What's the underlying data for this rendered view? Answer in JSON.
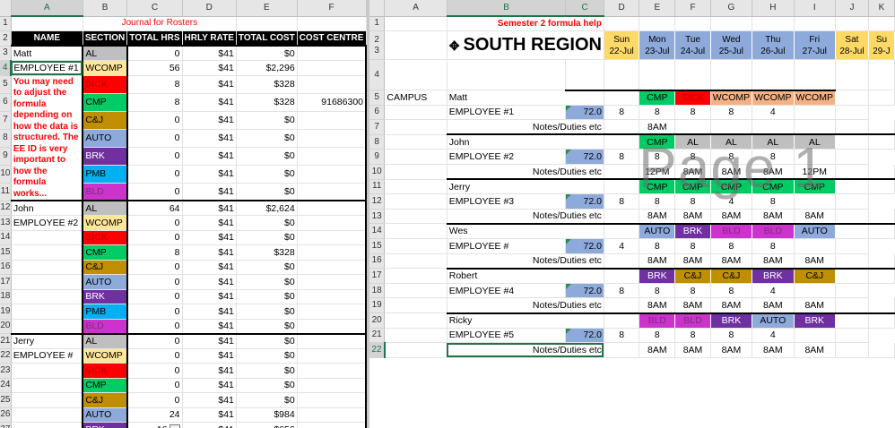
{
  "left": {
    "columns": [
      "A",
      "B",
      "C",
      "D",
      "E",
      "F"
    ],
    "row1_title": "Journal for Rosters",
    "headers": [
      "NAME",
      "SECTION",
      "TOTAL HRS",
      "HRLY RATE",
      "TOTAL COST",
      "COST CENTRE"
    ],
    "note": "You may need to adjust the formula depending on how the data is structured.  The EE ID is very important to how the formula works...",
    "rows": [
      {
        "n": "3",
        "a": "Matt",
        "b": "AL",
        "c": "0",
        "d": "$41",
        "e": "$0",
        "f": ""
      },
      {
        "n": "4",
        "a": "EMPLOYEE #1",
        "b": "WCOMP",
        "c": "56",
        "d": "$41",
        "e": "$2,296",
        "f": ""
      },
      {
        "n": "5",
        "a": "",
        "b": "SICK",
        "c": "8",
        "d": "$41",
        "e": "$328",
        "f": ""
      },
      {
        "n": "6",
        "a": "",
        "b": "CMP",
        "c": "8",
        "d": "$41",
        "e": "$328",
        "f": "91686300"
      },
      {
        "n": "7",
        "a": "",
        "b": "C&J",
        "c": "0",
        "d": "$41",
        "e": "$0",
        "f": ""
      },
      {
        "n": "8",
        "a": "",
        "b": "AUTO",
        "c": "0",
        "d": "$41",
        "e": "$0",
        "f": ""
      },
      {
        "n": "9",
        "a": "",
        "b": "BRK",
        "c": "0",
        "d": "$41",
        "e": "$0",
        "f": ""
      },
      {
        "n": "10",
        "a": "",
        "b": "PMB",
        "c": "0",
        "d": "$41",
        "e": "$0",
        "f": ""
      },
      {
        "n": "11",
        "a": "",
        "b": "BLD",
        "c": "0",
        "d": "$41",
        "e": "$0",
        "f": ""
      },
      {
        "n": "12",
        "a": "John",
        "b": "AL",
        "c": "64",
        "d": "$41",
        "e": "$2,624",
        "f": ""
      },
      {
        "n": "13",
        "a": "EMPLOYEE #2",
        "b": "WCOMP",
        "c": "0",
        "d": "$41",
        "e": "$0",
        "f": ""
      },
      {
        "n": "14",
        "a": "",
        "b": "SICK",
        "c": "0",
        "d": "$41",
        "e": "$0",
        "f": ""
      },
      {
        "n": "15",
        "a": "",
        "b": "CMP",
        "c": "8",
        "d": "$41",
        "e": "$328",
        "f": ""
      },
      {
        "n": "16",
        "a": "",
        "b": "C&J",
        "c": "0",
        "d": "$41",
        "e": "$0",
        "f": ""
      },
      {
        "n": "17",
        "a": "",
        "b": "AUTO",
        "c": "0",
        "d": "$41",
        "e": "$0",
        "f": ""
      },
      {
        "n": "18",
        "a": "",
        "b": "BRK",
        "c": "0",
        "d": "$41",
        "e": "$0",
        "f": ""
      },
      {
        "n": "19",
        "a": "",
        "b": "PMB",
        "c": "0",
        "d": "$41",
        "e": "$0",
        "f": ""
      },
      {
        "n": "20",
        "a": "",
        "b": "BLD",
        "c": "0",
        "d": "$41",
        "e": "$0",
        "f": ""
      },
      {
        "n": "21",
        "a": "Jerry",
        "b": "AL",
        "c": "0",
        "d": "$41",
        "e": "$0",
        "f": ""
      },
      {
        "n": "22",
        "a": "EMPLOYEE #",
        "b": "WCOMP",
        "c": "0",
        "d": "$41",
        "e": "$0",
        "f": ""
      },
      {
        "n": "23",
        "a": "",
        "b": "SICK",
        "c": "0",
        "d": "$41",
        "e": "$0",
        "f": ""
      },
      {
        "n": "24",
        "a": "",
        "b": "CMP",
        "c": "0",
        "d": "$41",
        "e": "$0",
        "f": ""
      },
      {
        "n": "25",
        "a": "",
        "b": "C&J",
        "c": "0",
        "d": "$41",
        "e": "$0",
        "f": ""
      },
      {
        "n": "26",
        "a": "",
        "b": "AUTO",
        "c": "24",
        "d": "$41",
        "e": "$984",
        "f": ""
      },
      {
        "n": "27",
        "a": "",
        "b": "BRK",
        "c": "16",
        "d": "$41",
        "e": "$656",
        "f": ""
      }
    ]
  },
  "right": {
    "columns": [
      "A",
      "B",
      "C",
      "D",
      "E",
      "F",
      "G",
      "H",
      "I",
      "J",
      "K"
    ],
    "row1_title": "Semester 2 formula help",
    "region_title": "SOUTH REGION",
    "campus_label": "CAMPUS",
    "watermark": "Page 1",
    "days": [
      {
        "day": "Sun",
        "date": "22-Jul",
        "weekend": true
      },
      {
        "day": "Mon",
        "date": "23-Jul",
        "weekend": false
      },
      {
        "day": "Tue",
        "date": "24-Jul",
        "weekend": false
      },
      {
        "day": "Wed",
        "date": "25-Jul",
        "weekend": false
      },
      {
        "day": "Thu",
        "date": "26-Jul",
        "weekend": false
      },
      {
        "day": "Fri",
        "date": "27-Jul",
        "weekend": false
      },
      {
        "day": "Sat",
        "date": "28-Jul",
        "weekend": true
      },
      {
        "day": "Su",
        "date": "29-J",
        "weekend": true
      }
    ],
    "notes_label": "Notes/Duties etc",
    "employees": [
      {
        "name": "Matt",
        "id": "EMPLOYEE #1",
        "total": "72.0",
        "codes": [
          "CMP",
          "SICK",
          "WCOMP",
          "WCOMP",
          "WCOMP"
        ],
        "hours": [
          "8",
          "8",
          "8",
          "8",
          "4"
        ],
        "times": [
          "8AM",
          "",
          "",
          "",
          ""
        ],
        "rows": [
          "5",
          "6",
          "7"
        ]
      },
      {
        "name": "John",
        "id": "EMPLOYEE #2",
        "total": "72.0",
        "codes": [
          "CMP",
          "AL",
          "AL",
          "AL",
          "AL"
        ],
        "hours": [
          "8",
          "8",
          "8",
          "8",
          "8"
        ],
        "times": [
          "12PM",
          "8AM",
          "8AM",
          "8AM",
          "12PM"
        ],
        "rows": [
          "8",
          "9",
          "10"
        ]
      },
      {
        "name": "Jerry",
        "id": "EMPLOYEE #3",
        "total": "72.0",
        "codes": [
          "CMP",
          "CMP",
          "CMP",
          "CMP",
          "CMP"
        ],
        "hours": [
          "8",
          "8",
          "8",
          "4",
          "8"
        ],
        "times": [
          "8AM",
          "8AM",
          "8AM",
          "8AM",
          "8AM"
        ],
        "rows": [
          "11",
          "12",
          "13"
        ]
      },
      {
        "name": "Wes",
        "id": "EMPLOYEE #",
        "total": "72.0",
        "codes": [
          "AUTO",
          "BRK",
          "BLD",
          "BLD",
          "AUTO"
        ],
        "hours": [
          "4",
          "8",
          "8",
          "8",
          "8"
        ],
        "times": [
          "8AM",
          "8AM",
          "8AM",
          "8AM",
          "8AM"
        ],
        "rows": [
          "14",
          "15",
          "16"
        ]
      },
      {
        "name": "Robert",
        "id": "EMPLOYEE #4",
        "total": "72.0",
        "codes": [
          "BRK",
          "C&J",
          "C&J",
          "BRK",
          "C&J"
        ],
        "hours": [
          "8",
          "8",
          "8",
          "8",
          "4"
        ],
        "times": [
          "8AM",
          "8AM",
          "8AM",
          "8AM",
          "8AM"
        ],
        "rows": [
          "17",
          "18",
          "19"
        ]
      },
      {
        "name": "Ricky",
        "id": "EMPLOYEE #5",
        "total": "72.0",
        "codes": [
          "BLD",
          "BLD",
          "BRK",
          "AUTO",
          "BRK"
        ],
        "hours": [
          "8",
          "8",
          "8",
          "8",
          "4"
        ],
        "times": [
          "8AM",
          "8AM",
          "8AM",
          "8AM",
          "8AM"
        ],
        "rows": [
          "20",
          "21",
          "22"
        ]
      }
    ]
  },
  "colors": {
    "AL": "#bfbfbf",
    "WCOMP": "#ffe699",
    "SICK": "#ff0000",
    "CMP": "#00cc66",
    "C&J": "#bf8f00",
    "AUTO": "#8eaadb",
    "BRK": "#7030a0",
    "PMB": "#00b0f0",
    "BLD": "#cc33cc",
    "weekend": "#ffd966",
    "weekday": "#8eaadb",
    "emp_total": "#8eaadb"
  },
  "text_colors": {
    "SICK": "#c00000",
    "BRK": "#ffffff",
    "BLD": "#7b2d7b",
    "AUTO": "#000000",
    "CMP": "#000000",
    "C&J": "#000000"
  }
}
